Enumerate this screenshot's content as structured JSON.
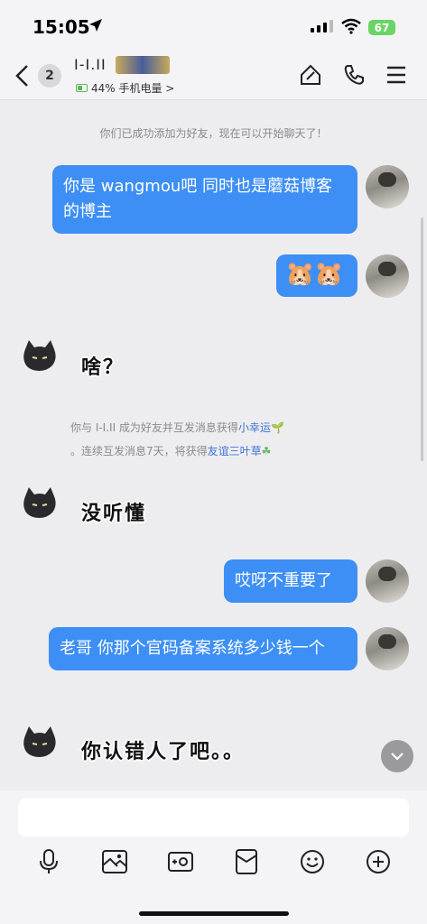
{
  "status_bar": {
    "time": "15:05",
    "battery": "67"
  },
  "nav": {
    "unread_count": "2",
    "contact_name": "I-I.II",
    "subtitle": "44% 手机电量 >"
  },
  "messages": {
    "system_added": "你们已成功添加为好友，现在可以开始聊天了！",
    "m1": "你是 wangmou吧 同时也是蘑菇博客的博主",
    "m2_emoji": "🐹🐹",
    "m3": "啥？",
    "system_friend_prefix": "你与 I-I.II 成为好友并互发消息获得",
    "system_friend_link1": "小幸运",
    "system_friend_mid": "。连续互发消息7天，将获得",
    "system_friend_link2": "友谊三叶草",
    "m4": "没听懂",
    "m5": "哎呀不重要了",
    "m6": "老哥 你那个官码备案系统多少钱一个",
    "m7": "你认错人了吧。。"
  },
  "input": {
    "value": "",
    "placeholder": ""
  },
  "colors": {
    "bubble": "#3d8ff5",
    "link": "#3f73d6",
    "battery": "#6bd466"
  },
  "icons": [
    "back-icon",
    "home-icon",
    "phone-icon",
    "menu-icon",
    "mic-icon",
    "image-icon",
    "camera-icon",
    "redpacket-icon",
    "emoji-icon",
    "plus-icon",
    "chevron-down-icon"
  ]
}
